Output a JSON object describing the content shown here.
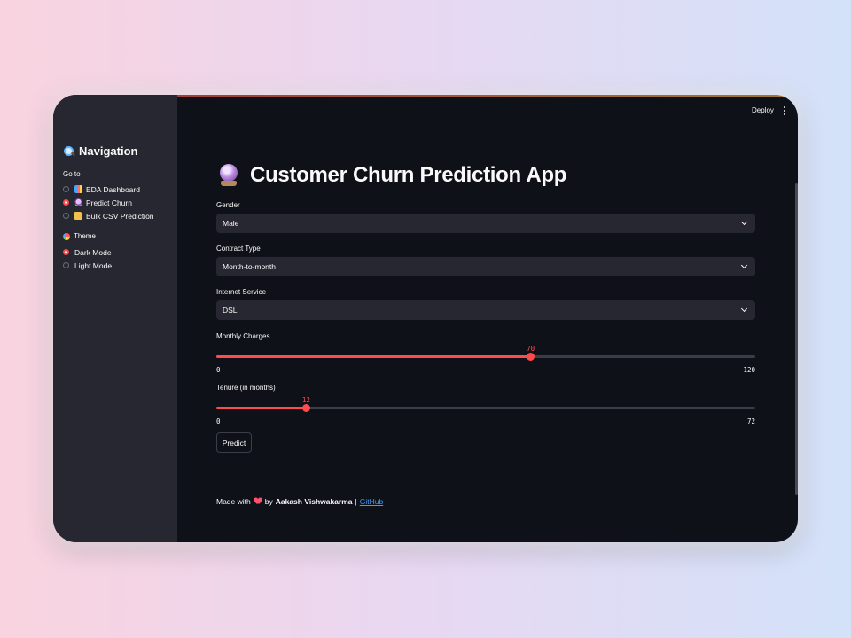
{
  "header": {
    "deploy_label": "Deploy",
    "menu_icon": "kebab-menu-icon"
  },
  "sidebar": {
    "title": "Navigation",
    "title_icon": "magnifier-icon",
    "goto_label": "Go to",
    "pages": [
      {
        "label": "EDA Dashboard",
        "icon": "bar-chart-icon",
        "selected": false
      },
      {
        "label": "Predict Churn",
        "icon": "crystal-ball-icon",
        "selected": true
      },
      {
        "label": "Bulk CSV Prediction",
        "icon": "folder-icon",
        "selected": false
      }
    ],
    "theme_label": "Theme",
    "theme_icon": "palette-icon",
    "themes": [
      {
        "label": "Dark Mode",
        "selected": true
      },
      {
        "label": "Light Mode",
        "selected": false
      }
    ]
  },
  "main": {
    "title": "Customer Churn Prediction App",
    "title_icon": "crystal-ball-icon",
    "gender": {
      "label": "Gender",
      "value": "Male"
    },
    "contract": {
      "label": "Contract Type",
      "value": "Month-to-month"
    },
    "internet": {
      "label": "Internet Service",
      "value": "DSL"
    },
    "monthly_charges": {
      "label": "Monthly Charges",
      "value": 70,
      "min": 0,
      "max": 120
    },
    "tenure": {
      "label": "Tenure (in months)",
      "value": 12,
      "min": 0,
      "max": 72
    },
    "predict_label": "Predict",
    "footer": {
      "made_with": "Made with",
      "by": "by",
      "author": "Aakash Vishwakarma",
      "separator": "|",
      "link_text": "GitHub"
    }
  },
  "colors": {
    "accent": "#ff4b4b",
    "background": "#0e1117",
    "sidebar": "#262730",
    "link": "#3c9dff"
  }
}
